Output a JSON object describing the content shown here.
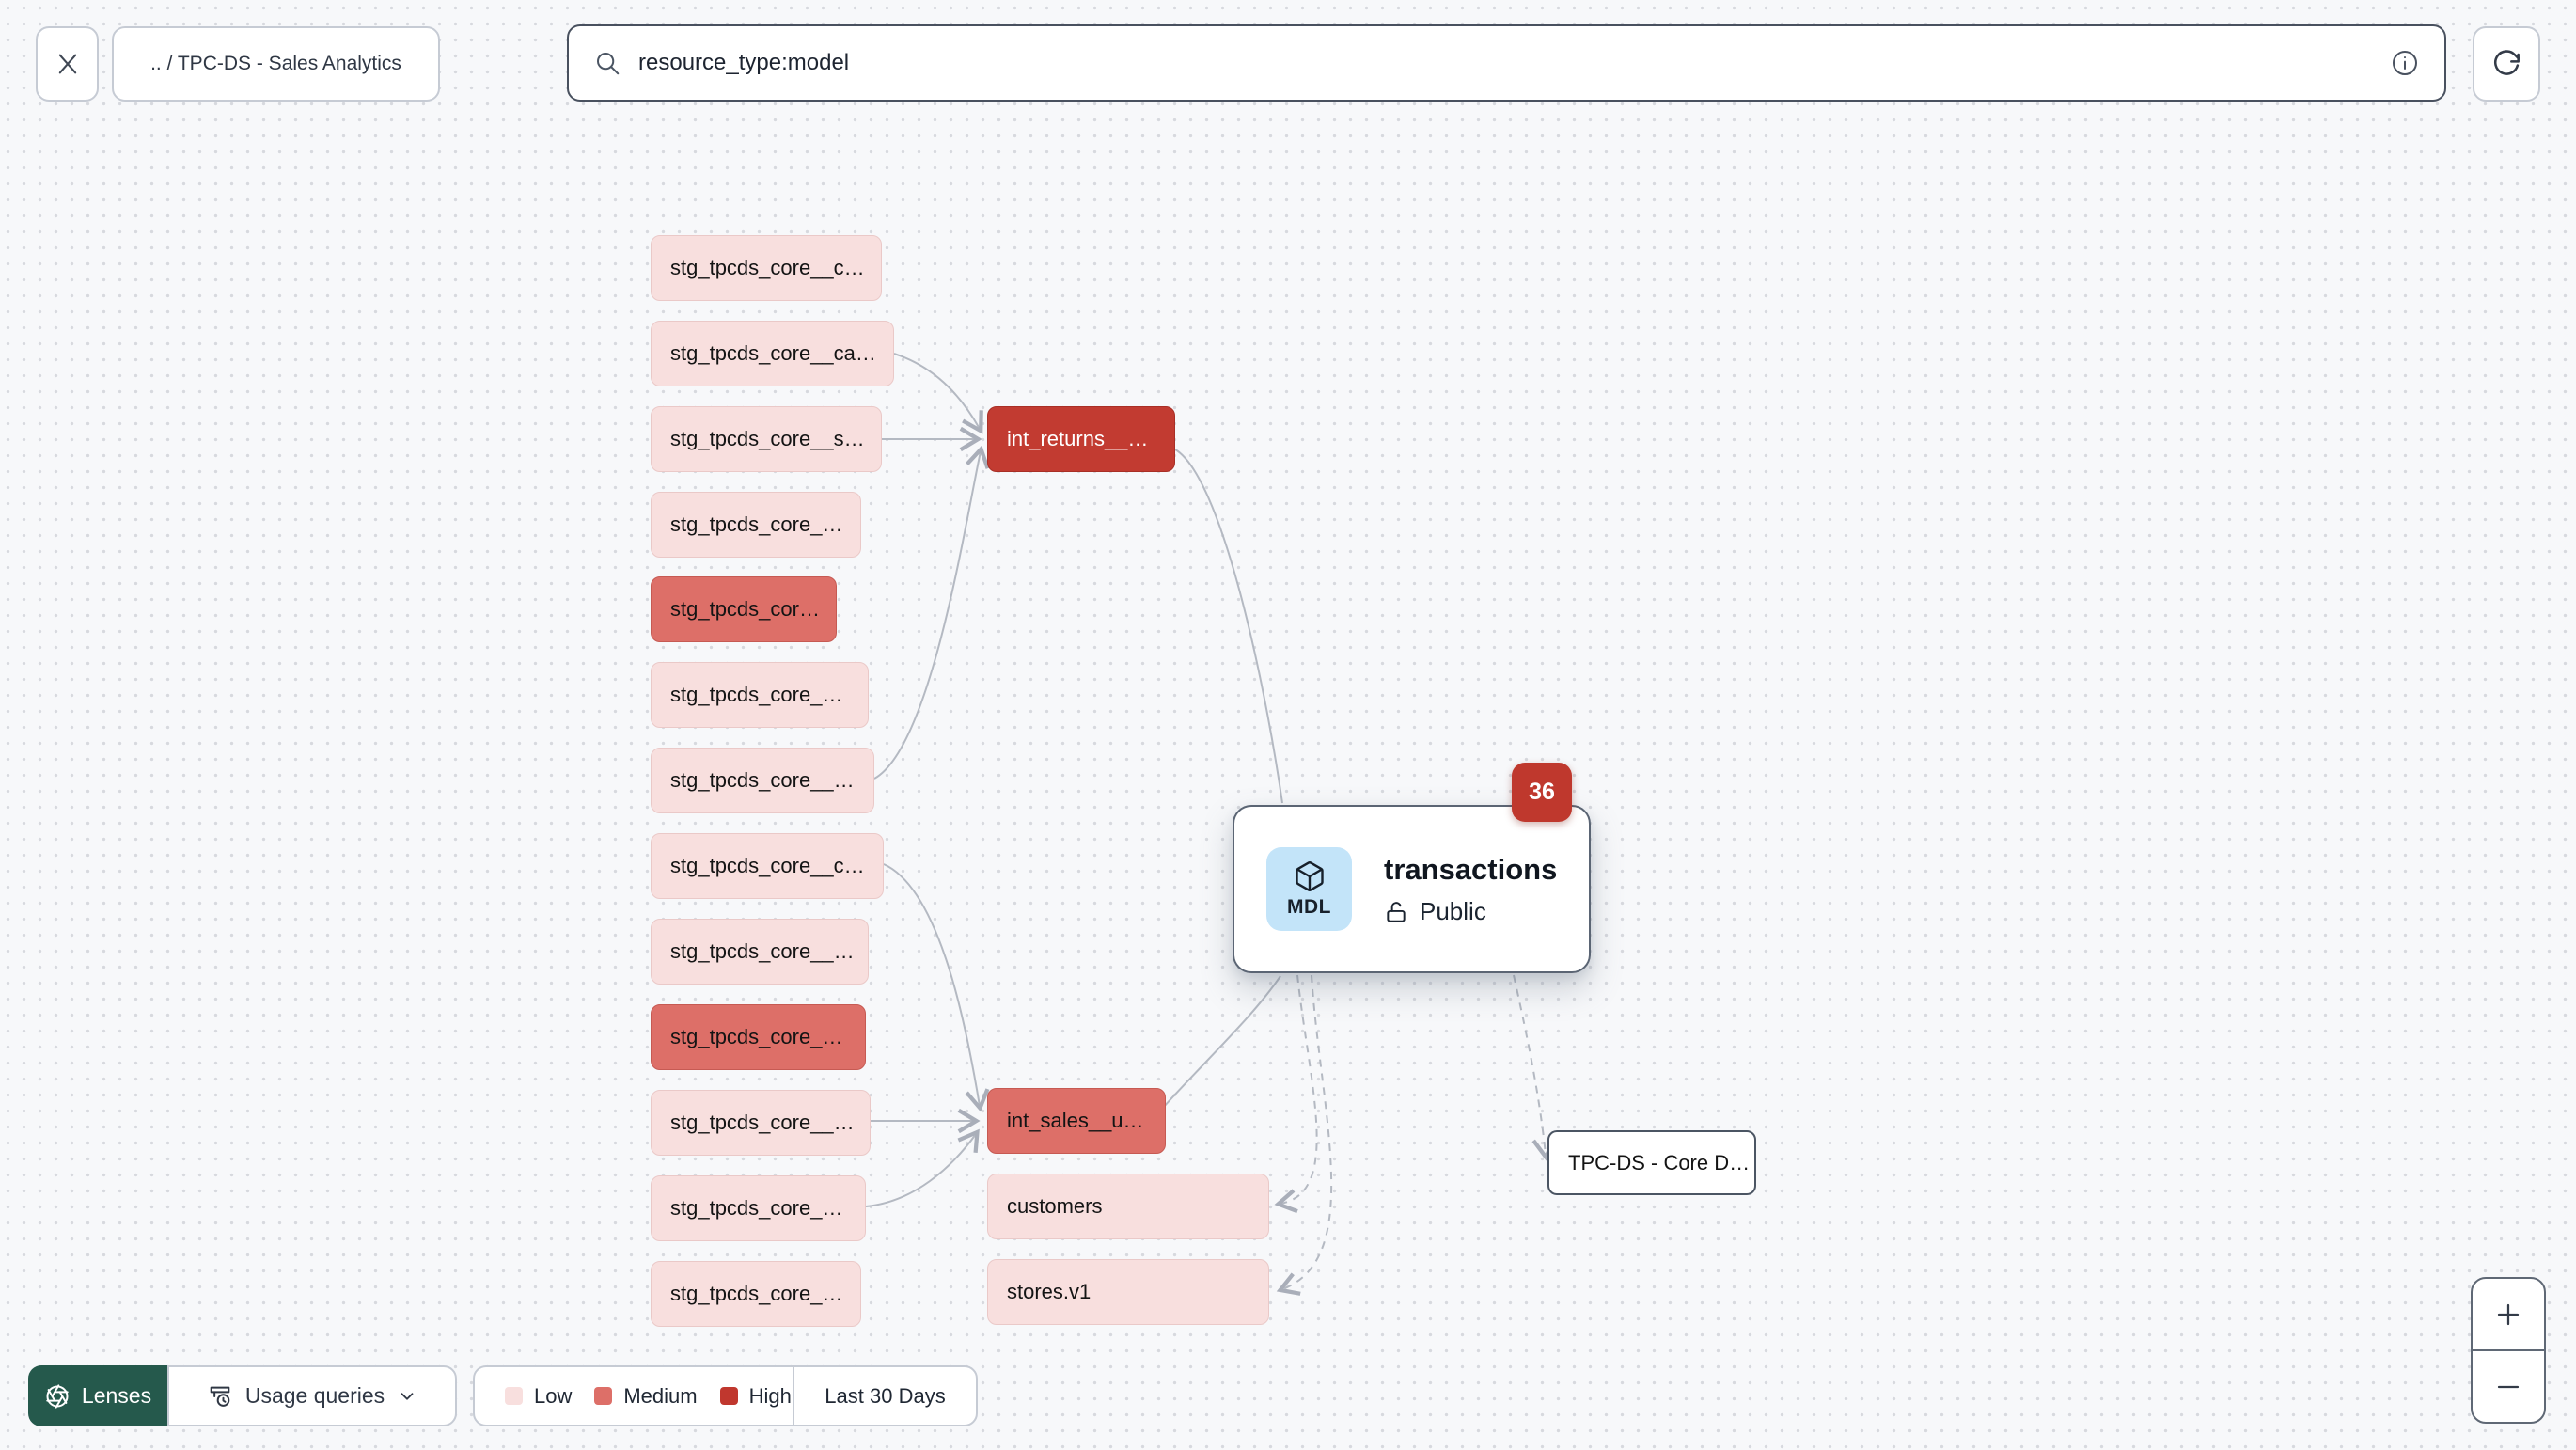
{
  "header": {
    "breadcrumb": ".. / TPC-DS - Sales Analytics",
    "search": {
      "value": "resource_type:model"
    }
  },
  "graph": {
    "staging_nodes": [
      {
        "label": "stg_tpcds_core__c…",
        "level": "low"
      },
      {
        "label": "stg_tpcds_core__ca…",
        "level": "low"
      },
      {
        "label": "stg_tpcds_core__s…",
        "level": "low"
      },
      {
        "label": "stg_tpcds_core_…",
        "level": "low"
      },
      {
        "label": "stg_tpcds_cor…",
        "level": "medium"
      },
      {
        "label": "stg_tpcds_core_…",
        "level": "low"
      },
      {
        "label": "stg_tpcds_core__…",
        "level": "low"
      },
      {
        "label": "stg_tpcds_core__c…",
        "level": "low"
      },
      {
        "label": "stg_tpcds_core__…",
        "level": "low"
      },
      {
        "label": "stg_tpcds_core_…",
        "level": "medium"
      },
      {
        "label": "stg_tpcds_core__…",
        "level": "low"
      },
      {
        "label": "stg_tpcds_core_…",
        "level": "low"
      },
      {
        "label": "stg_tpcds_core_…",
        "level": "low"
      }
    ],
    "int_returns": {
      "label": "int_returns__…",
      "level": "high"
    },
    "int_sales": {
      "label": "int_sales__u…",
      "level": "medium"
    },
    "customers": {
      "label": "customers",
      "level": "low"
    },
    "stores": {
      "label": "stores.v1",
      "level": "low"
    },
    "focus_card": {
      "badge_count": "36",
      "type_label": "MDL",
      "title": "transactions",
      "access_label": "Public"
    },
    "exposure_node": {
      "label": "TPC-DS - Core D…"
    }
  },
  "footer": {
    "lenses_label": "Lenses",
    "usage_queries_label": "Usage queries",
    "legend": {
      "items": [
        {
          "label": "Low",
          "color": "#f8dfde"
        },
        {
          "label": "Medium",
          "color": "#dd6f68"
        },
        {
          "label": "High",
          "color": "#c0372e"
        }
      ]
    },
    "time_range_label": "Last 30 Days"
  },
  "colors": {
    "background": "#f7f8fa",
    "low": "#f8dfde",
    "medium": "#dd6f68",
    "high": "#c23b31",
    "badge_red": "#bf382d",
    "model_badge_blue": "#c3e4f9",
    "lenses_green": "#25594c",
    "edge_gray": "#b4b9c2"
  }
}
